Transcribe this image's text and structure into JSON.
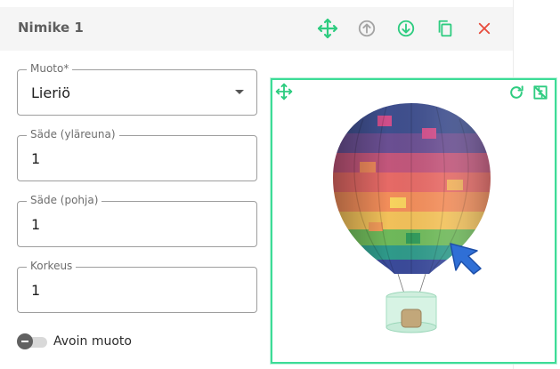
{
  "header": {
    "title": "Nimike 1"
  },
  "form": {
    "shape": {
      "label": "Muoto*",
      "value": "Lieriö"
    },
    "radius_top": {
      "label": "Säde (yläreuna)",
      "value": "1"
    },
    "radius_bottom": {
      "label": "Säde (pohja)",
      "value": "1"
    },
    "height": {
      "label": "Korkeus",
      "value": "1"
    },
    "open_shape": {
      "label": "Avoin muoto",
      "checked": false
    }
  },
  "colors": {
    "accent": "#2ecc80",
    "danger": "#e74c3c",
    "muted": "#9e9e9e"
  }
}
